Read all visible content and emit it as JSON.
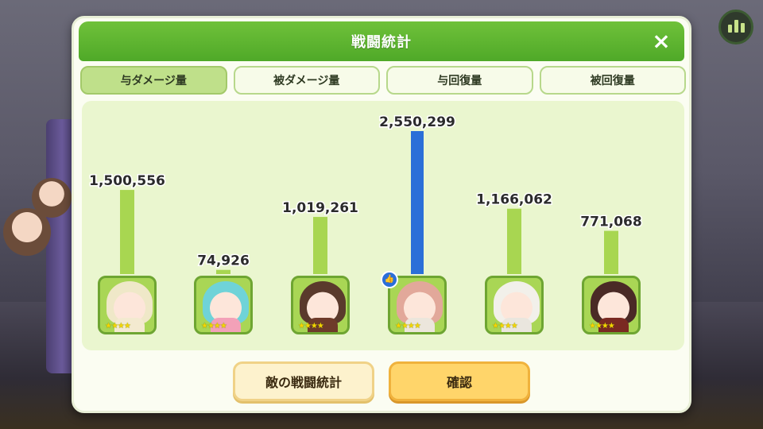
{
  "panel": {
    "title": "戦闘統計",
    "close_icon": "×"
  },
  "tabs": [
    {
      "label": "与ダメージ量",
      "active": true
    },
    {
      "label": "被ダメージ量",
      "active": false
    },
    {
      "label": "与回復量",
      "active": false
    },
    {
      "label": "被回復量",
      "active": false
    }
  ],
  "chart_data": {
    "type": "bar",
    "categories": [
      "hero-1",
      "hero-2",
      "hero-3",
      "hero-4",
      "hero-5",
      "hero-6"
    ],
    "values": [
      1500556,
      74926,
      1019261,
      2550299,
      1166062,
      771068
    ],
    "value_labels": [
      "1,500,556",
      "74,926",
      "1,019,261",
      "2,550,299",
      "1,166,062",
      "771,068"
    ],
    "highlighted_index": 3,
    "colors": {
      "bar": "#a8d651",
      "highlight": "#2a6fd8"
    },
    "title": "",
    "xlabel": "",
    "ylabel": ""
  },
  "heroes": [
    {
      "hair": "#efe8c8",
      "body": "#f3ead0",
      "stars": "★★★★"
    },
    {
      "hair": "#6fd3d8",
      "body": "#f3a1b8",
      "stars": "★★★★"
    },
    {
      "hair": "#5a3a2c",
      "body": "#6e3b2a",
      "stars": "★★★★"
    },
    {
      "hair": "#e2a89a",
      "body": "#ece6dc",
      "stars": "★★★★"
    },
    {
      "hair": "#f2f0ea",
      "body": "#eae6de",
      "stars": "★★★★"
    },
    {
      "hair": "#4a2a26",
      "body": "#7a2a22",
      "stars": "★★★★"
    }
  ],
  "buttons": {
    "enemy_stats": "敵の戦闘統計",
    "confirm": "確認"
  }
}
